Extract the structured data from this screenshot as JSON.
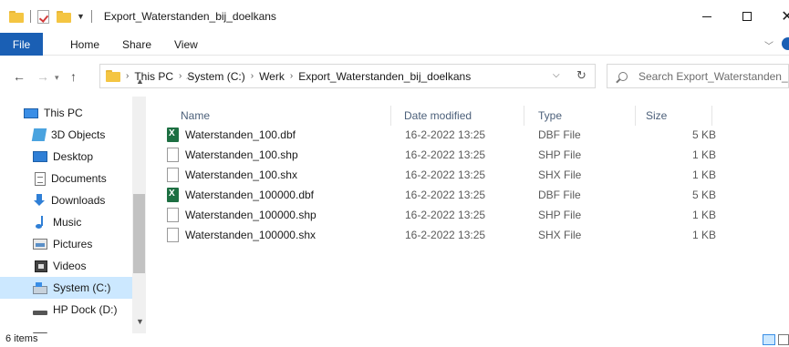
{
  "window": {
    "title": "Export_Waterstanden_bij_doelkans",
    "minimize_glyph": "—",
    "close_glyph": "✕"
  },
  "ribbon": {
    "tabs": [
      "File",
      "Home",
      "Share",
      "View"
    ]
  },
  "address": {
    "crumbs": [
      "This PC",
      "System (C:)",
      "Werk",
      "Export_Waterstanden_bij_doelkans"
    ],
    "search_placeholder": "Search Export_Waterstanden_bij_doelkans"
  },
  "nav": {
    "items": [
      {
        "label": "This PC",
        "icon": "computer-icon"
      },
      {
        "label": "3D Objects",
        "icon": "3d-objects-icon"
      },
      {
        "label": "Desktop",
        "icon": "desktop-icon"
      },
      {
        "label": "Documents",
        "icon": "documents-icon"
      },
      {
        "label": "Downloads",
        "icon": "downloads-icon"
      },
      {
        "label": "Music",
        "icon": "music-icon"
      },
      {
        "label": "Pictures",
        "icon": "pictures-icon"
      },
      {
        "label": "Videos",
        "icon": "videos-icon"
      },
      {
        "label": "System (C:)",
        "icon": "drive-icon",
        "selected": true
      },
      {
        "label": "HP Dock (D:)",
        "icon": "dock-icon"
      }
    ]
  },
  "columns": {
    "name": "Name",
    "date": "Date modified",
    "type": "Type",
    "size": "Size"
  },
  "files": [
    {
      "name": "Waterstanden_100.dbf",
      "date": "16-2-2022 13:25",
      "type": "DBF File",
      "size": "5 KB",
      "icon": "excel-file-icon"
    },
    {
      "name": "Waterstanden_100.shp",
      "date": "16-2-2022 13:25",
      "type": "SHP File",
      "size": "1 KB",
      "icon": "file-icon"
    },
    {
      "name": "Waterstanden_100.shx",
      "date": "16-2-2022 13:25",
      "type": "SHX File",
      "size": "1 KB",
      "icon": "file-icon"
    },
    {
      "name": "Waterstanden_100000.dbf",
      "date": "16-2-2022 13:25",
      "type": "DBF File",
      "size": "5 KB",
      "icon": "excel-file-icon"
    },
    {
      "name": "Waterstanden_100000.shp",
      "date": "16-2-2022 13:25",
      "type": "SHP File",
      "size": "1 KB",
      "icon": "file-icon"
    },
    {
      "name": "Waterstanden_100000.shx",
      "date": "16-2-2022 13:25",
      "type": "SHX File",
      "size": "1 KB",
      "icon": "file-icon"
    }
  ],
  "status": {
    "count": "6 items"
  },
  "colors": {
    "accent": "#1a5fb4",
    "selection": "#cce8ff",
    "folder": "#f4c542"
  }
}
